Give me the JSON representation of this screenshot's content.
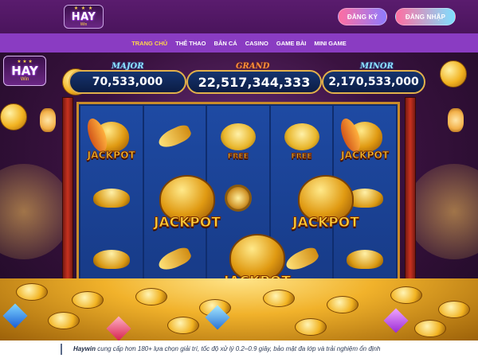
{
  "header": {
    "logo": {
      "stars": "★ ★ ★",
      "word": "HAY",
      "sub": "Win"
    },
    "register_label": "Đăng ký",
    "login_label": "Đăng nhập"
  },
  "nav": {
    "items": [
      {
        "label": "Trang chủ",
        "active": true
      },
      {
        "label": "Thể thao",
        "active": false
      },
      {
        "label": "Bắn cá",
        "active": false
      },
      {
        "label": "Casino",
        "active": false
      },
      {
        "label": "Game bài",
        "active": false
      },
      {
        "label": "Mini game",
        "active": false
      }
    ]
  },
  "banner": {
    "logo": {
      "stars": "★ ★ ★",
      "word": "HAY",
      "sub": "Win"
    },
    "jackpots": {
      "major": {
        "label": "Major",
        "value": "70,533,000"
      },
      "grand": {
        "label": "Grand",
        "value": "22,517,344,333"
      },
      "minor": {
        "label": "Minor",
        "value": "2,170,533,000"
      }
    },
    "symbols": {
      "jackpot": "JACKPOT",
      "free": "FREE"
    }
  },
  "caption": {
    "brand": "Haywin",
    "text": " cung cấp hơn 180+ lựa chọn giải trí, tốc độ xử lý 0.2–0.9 giây, bảo mật đa lớp và trải nghiệm ổn định"
  },
  "colors": {
    "header_bg": "#4a145c",
    "nav_bg": "#8a3cc2",
    "nav_active": "#ffd54a",
    "jackpot_text": "#ffd23a"
  }
}
